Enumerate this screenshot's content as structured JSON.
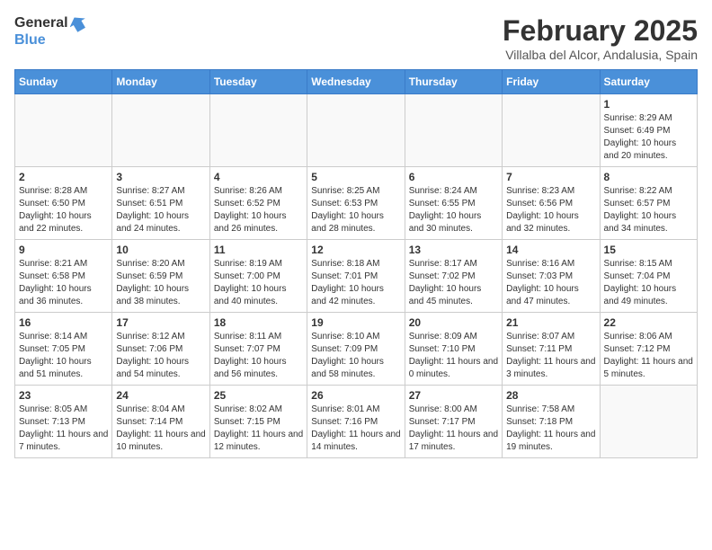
{
  "header": {
    "logo_line1": "General",
    "logo_line2": "Blue",
    "month_title": "February 2025",
    "location": "Villalba del Alcor, Andalusia, Spain"
  },
  "days_of_week": [
    "Sunday",
    "Monday",
    "Tuesday",
    "Wednesday",
    "Thursday",
    "Friday",
    "Saturday"
  ],
  "weeks": [
    [
      {
        "day": "",
        "info": ""
      },
      {
        "day": "",
        "info": ""
      },
      {
        "day": "",
        "info": ""
      },
      {
        "day": "",
        "info": ""
      },
      {
        "day": "",
        "info": ""
      },
      {
        "day": "",
        "info": ""
      },
      {
        "day": "1",
        "info": "Sunrise: 8:29 AM\nSunset: 6:49 PM\nDaylight: 10 hours and 20 minutes."
      }
    ],
    [
      {
        "day": "2",
        "info": "Sunrise: 8:28 AM\nSunset: 6:50 PM\nDaylight: 10 hours and 22 minutes."
      },
      {
        "day": "3",
        "info": "Sunrise: 8:27 AM\nSunset: 6:51 PM\nDaylight: 10 hours and 24 minutes."
      },
      {
        "day": "4",
        "info": "Sunrise: 8:26 AM\nSunset: 6:52 PM\nDaylight: 10 hours and 26 minutes."
      },
      {
        "day": "5",
        "info": "Sunrise: 8:25 AM\nSunset: 6:53 PM\nDaylight: 10 hours and 28 minutes."
      },
      {
        "day": "6",
        "info": "Sunrise: 8:24 AM\nSunset: 6:55 PM\nDaylight: 10 hours and 30 minutes."
      },
      {
        "day": "7",
        "info": "Sunrise: 8:23 AM\nSunset: 6:56 PM\nDaylight: 10 hours and 32 minutes."
      },
      {
        "day": "8",
        "info": "Sunrise: 8:22 AM\nSunset: 6:57 PM\nDaylight: 10 hours and 34 minutes."
      }
    ],
    [
      {
        "day": "9",
        "info": "Sunrise: 8:21 AM\nSunset: 6:58 PM\nDaylight: 10 hours and 36 minutes."
      },
      {
        "day": "10",
        "info": "Sunrise: 8:20 AM\nSunset: 6:59 PM\nDaylight: 10 hours and 38 minutes."
      },
      {
        "day": "11",
        "info": "Sunrise: 8:19 AM\nSunset: 7:00 PM\nDaylight: 10 hours and 40 minutes."
      },
      {
        "day": "12",
        "info": "Sunrise: 8:18 AM\nSunset: 7:01 PM\nDaylight: 10 hours and 42 minutes."
      },
      {
        "day": "13",
        "info": "Sunrise: 8:17 AM\nSunset: 7:02 PM\nDaylight: 10 hours and 45 minutes."
      },
      {
        "day": "14",
        "info": "Sunrise: 8:16 AM\nSunset: 7:03 PM\nDaylight: 10 hours and 47 minutes."
      },
      {
        "day": "15",
        "info": "Sunrise: 8:15 AM\nSunset: 7:04 PM\nDaylight: 10 hours and 49 minutes."
      }
    ],
    [
      {
        "day": "16",
        "info": "Sunrise: 8:14 AM\nSunset: 7:05 PM\nDaylight: 10 hours and 51 minutes."
      },
      {
        "day": "17",
        "info": "Sunrise: 8:12 AM\nSunset: 7:06 PM\nDaylight: 10 hours and 54 minutes."
      },
      {
        "day": "18",
        "info": "Sunrise: 8:11 AM\nSunset: 7:07 PM\nDaylight: 10 hours and 56 minutes."
      },
      {
        "day": "19",
        "info": "Sunrise: 8:10 AM\nSunset: 7:09 PM\nDaylight: 10 hours and 58 minutes."
      },
      {
        "day": "20",
        "info": "Sunrise: 8:09 AM\nSunset: 7:10 PM\nDaylight: 11 hours and 0 minutes."
      },
      {
        "day": "21",
        "info": "Sunrise: 8:07 AM\nSunset: 7:11 PM\nDaylight: 11 hours and 3 minutes."
      },
      {
        "day": "22",
        "info": "Sunrise: 8:06 AM\nSunset: 7:12 PM\nDaylight: 11 hours and 5 minutes."
      }
    ],
    [
      {
        "day": "23",
        "info": "Sunrise: 8:05 AM\nSunset: 7:13 PM\nDaylight: 11 hours and 7 minutes."
      },
      {
        "day": "24",
        "info": "Sunrise: 8:04 AM\nSunset: 7:14 PM\nDaylight: 11 hours and 10 minutes."
      },
      {
        "day": "25",
        "info": "Sunrise: 8:02 AM\nSunset: 7:15 PM\nDaylight: 11 hours and 12 minutes."
      },
      {
        "day": "26",
        "info": "Sunrise: 8:01 AM\nSunset: 7:16 PM\nDaylight: 11 hours and 14 minutes."
      },
      {
        "day": "27",
        "info": "Sunrise: 8:00 AM\nSunset: 7:17 PM\nDaylight: 11 hours and 17 minutes."
      },
      {
        "day": "28",
        "info": "Sunrise: 7:58 AM\nSunset: 7:18 PM\nDaylight: 11 hours and 19 minutes."
      },
      {
        "day": "",
        "info": ""
      }
    ]
  ]
}
